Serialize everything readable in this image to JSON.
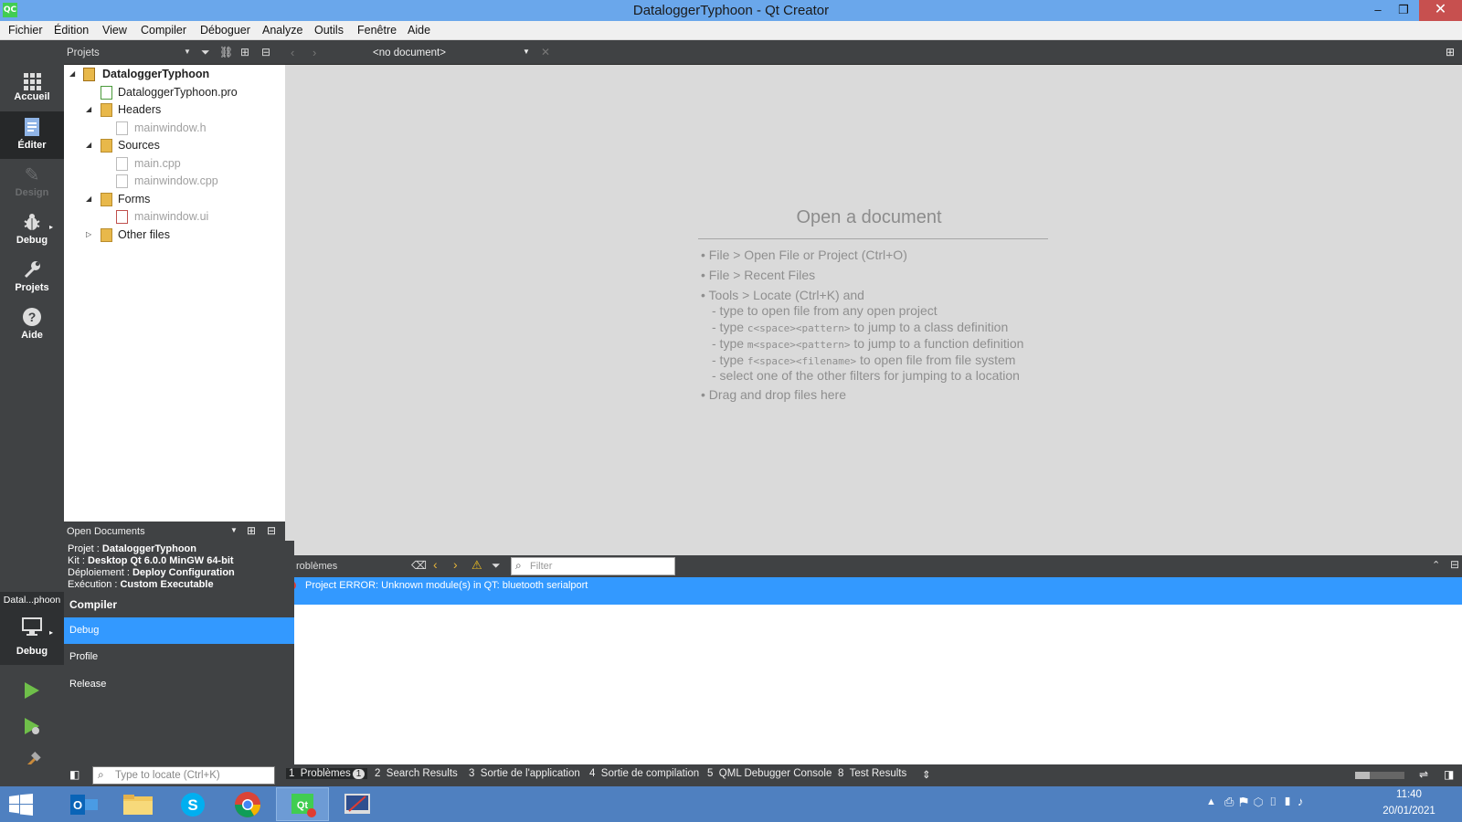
{
  "window": {
    "title": "DataloggerTyphoon - Qt Creator",
    "app_icon": "QC"
  },
  "menu": [
    "Fichier",
    "Édition",
    "View",
    "Compiler",
    "Déboguer",
    "Analyze",
    "Outils",
    "Fenêtre",
    "Aide"
  ],
  "modes": [
    {
      "label": "Accueil",
      "icon": "grid-icon"
    },
    {
      "label": "Éditer",
      "icon": "edit-document-icon"
    },
    {
      "label": "Design",
      "icon": "pencil-icon"
    },
    {
      "label": "Debug",
      "icon": "bug-icon"
    },
    {
      "label": "Projets",
      "icon": "wrench-icon"
    },
    {
      "label": "Aide",
      "icon": "help-icon"
    }
  ],
  "projects_pane": {
    "title": "Projets",
    "tree": [
      {
        "label": "DataloggerTyphoon",
        "level": 0,
        "expanded": true,
        "type": "project"
      },
      {
        "label": "DataloggerTyphoon.pro",
        "level": 1,
        "type": "pro-file"
      },
      {
        "label": "Headers",
        "level": 1,
        "expanded": true,
        "type": "folder"
      },
      {
        "label": "mainwindow.h",
        "level": 2,
        "type": "file"
      },
      {
        "label": "Sources",
        "level": 1,
        "expanded": true,
        "type": "folder"
      },
      {
        "label": "main.cpp",
        "level": 2,
        "type": "file"
      },
      {
        "label": "mainwindow.cpp",
        "level": 2,
        "type": "file"
      },
      {
        "label": "Forms",
        "level": 1,
        "expanded": true,
        "type": "folder"
      },
      {
        "label": "mainwindow.ui",
        "level": 2,
        "type": "ui-file"
      },
      {
        "label": "Other files",
        "level": 1,
        "expanded": false,
        "type": "folder"
      }
    ]
  },
  "open_documents": {
    "title": "Open Documents"
  },
  "editor": {
    "document_selector": "<no document>",
    "open_doc_title": "Open a document",
    "hints": {
      "h1": "• File > Open File or Project (Ctrl+O)",
      "h2": "• File > Recent Files",
      "h3": "• Tools > Locate (Ctrl+K) and",
      "h4": "- type to open file from any open project",
      "h5a": "- type ",
      "h5code": "c<space><pattern>",
      "h5b": " to jump to a class definition",
      "h6a": "- type ",
      "h6code": "m<space><pattern>",
      "h6b": " to jump to a function definition",
      "h7a": "- type ",
      "h7code": "f<space><filename>",
      "h7b": " to open file from file system",
      "h8": "- select one of the other filters for jumping to a location",
      "h9": "• Drag and drop files here"
    }
  },
  "output": {
    "title": "roblèmes",
    "filter_placeholder": "Filter",
    "error": "Project ERROR: Unknown module(s) in QT: bluetooth serialport"
  },
  "kit_popup": {
    "projet_label": "Projet : ",
    "projet": "DataloggerTyphoon",
    "kit_label": "Kit : ",
    "kit": "Desktop Qt 6.0.0 MinGW 64-bit",
    "deploy_label": "Déploiement : ",
    "deploy": "Deploy Configuration",
    "exec_label": "Exécution : ",
    "exec": "Custom Executable",
    "compiler_title": "Compiler",
    "options": [
      "Debug",
      "Profile",
      "Release"
    ],
    "selected": "Debug"
  },
  "kit_selector": {
    "name": "Datal...phoon",
    "mode": "Debug"
  },
  "status_tabs": [
    {
      "num": "1",
      "label": "Problèmes",
      "badge": "1"
    },
    {
      "num": "2",
      "label": "Search Results"
    },
    {
      "num": "3",
      "label": "Sortie de l'application"
    },
    {
      "num": "4",
      "label": "Sortie de compilation"
    },
    {
      "num": "5",
      "label": "QML Debugger Console"
    },
    {
      "num": "8",
      "label": "Test Results"
    }
  ],
  "locator": {
    "placeholder": "Type to locate (Ctrl+K)"
  },
  "taskbar": {
    "time": "11:40",
    "date": "20/01/2021",
    "apps": [
      "Outlook",
      "File Explorer",
      "Skype",
      "Chrome",
      "Qt Creator",
      "Qt Designer"
    ]
  },
  "colors": {
    "titlebar": "#6aa7eb",
    "selection": "#3399ff",
    "sidebar": "#404244",
    "taskbar": "#4f80c0"
  }
}
